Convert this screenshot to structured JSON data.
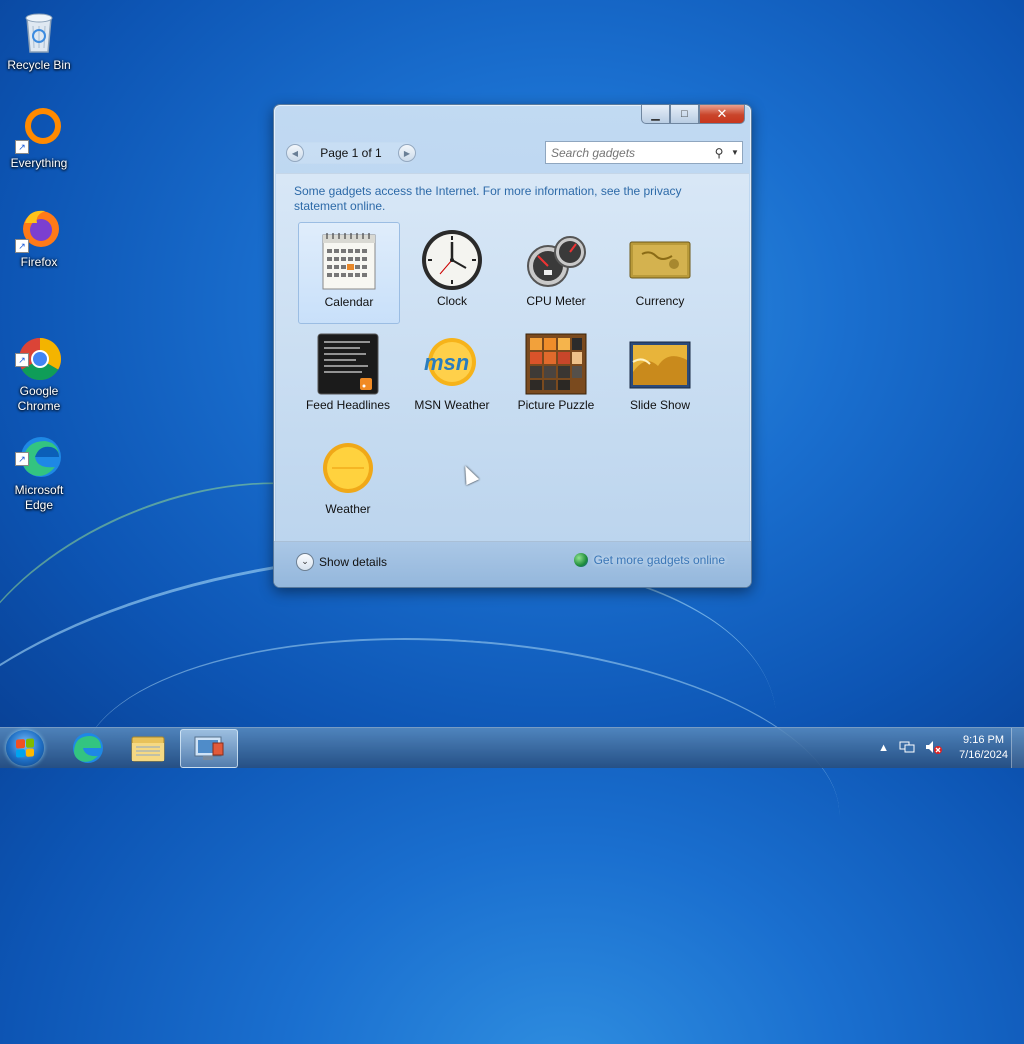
{
  "desktop": {
    "icons": [
      {
        "label": "Recycle Bin",
        "icon": "recycle-bin-icon"
      },
      {
        "label": "Everything",
        "icon": "everything-icon"
      },
      {
        "label": "Firefox",
        "icon": "firefox-icon"
      },
      {
        "label": "Google\nChrome",
        "icon": "chrome-icon"
      },
      {
        "label": "Microsoft\nEdge",
        "icon": "edge-icon"
      }
    ]
  },
  "gadget_window": {
    "pager": {
      "label": "Page 1 of 1"
    },
    "search": {
      "placeholder": "Search gadgets"
    },
    "info_text": "Some gadgets access the Internet.  For more information, see the privacy statement online.",
    "gadgets": [
      {
        "label": "Calendar",
        "selected": true
      },
      {
        "label": "Clock"
      },
      {
        "label": "CPU Meter"
      },
      {
        "label": "Currency"
      },
      {
        "label": "Feed Headlines"
      },
      {
        "label": "MSN Weather"
      },
      {
        "label": "Picture Puzzle"
      },
      {
        "label": "Slide Show"
      },
      {
        "label": "Weather"
      }
    ],
    "footer": {
      "show_details": "Show details",
      "get_more": "Get more gadgets online"
    }
  },
  "taskbar": {
    "clock_time": "9:16 PM",
    "clock_date": "7/16/2024"
  },
  "colors": {
    "link_blue": "#2d6aa8",
    "close_red": "#c8361d"
  }
}
